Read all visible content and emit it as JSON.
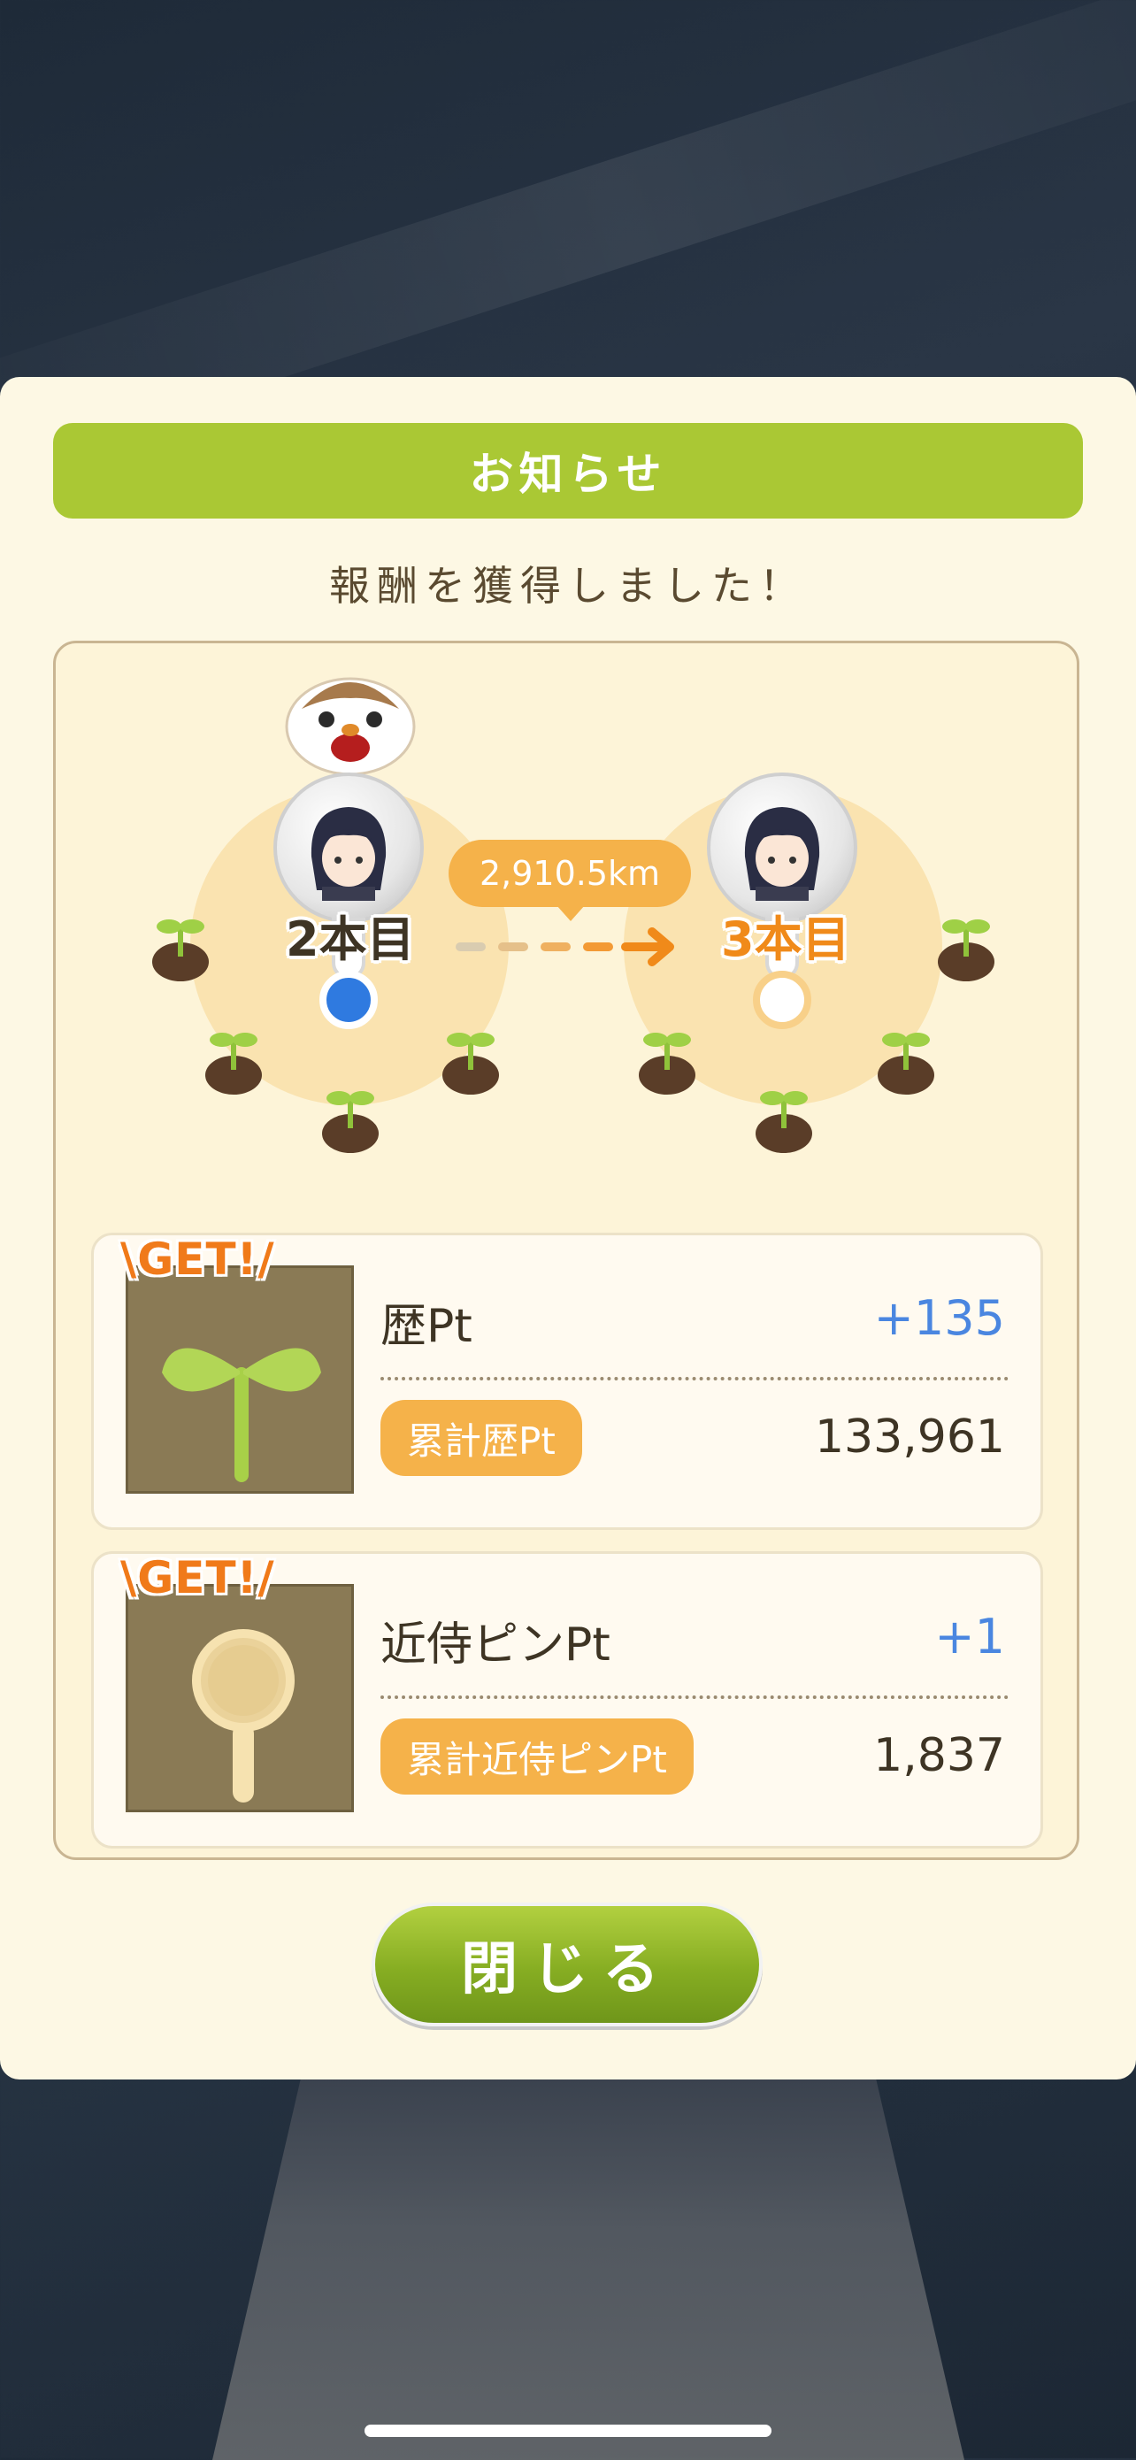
{
  "dialog": {
    "header_title": "お知らせ",
    "message": "報酬を獲得しました！",
    "close_label": "閉じる"
  },
  "progress": {
    "from_label": "2本目",
    "to_label": "3本目",
    "distance": "2,910.5km"
  },
  "rewards": [
    {
      "badge": "\\GET!/",
      "name": "歴Pt",
      "gain": "+135",
      "total_label": "累計歴Pt",
      "total_value": "133,961",
      "icon": "sprout-icon"
    },
    {
      "badge": "\\GET!/",
      "name": "近侍ピンPt",
      "gain": "+1",
      "total_label": "累計近侍ピンPt",
      "total_value": "1,837",
      "icon": "pin-icon"
    }
  ],
  "colors": {
    "header_green": "#aac834",
    "accent_orange": "#f5b24a",
    "gain_blue": "#4a86e0",
    "label_dark": "#3e3424",
    "current_blue": "#2f7ae0",
    "next_orange": "#f08a1a"
  }
}
